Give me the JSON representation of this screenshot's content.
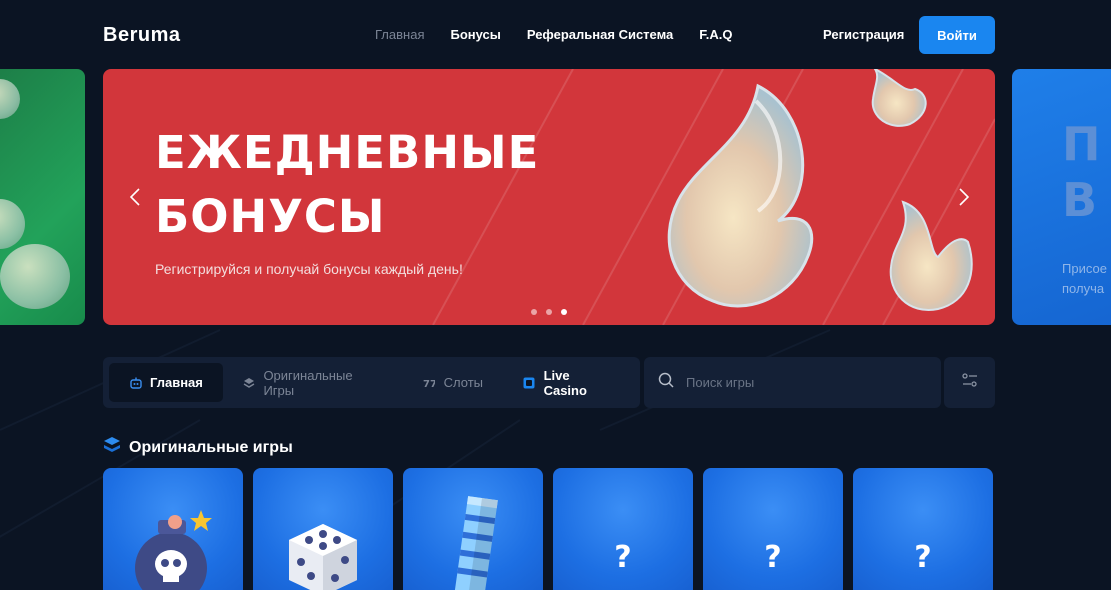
{
  "header": {
    "logo": "Beruma",
    "nav": [
      {
        "label": "Главная",
        "active": true
      },
      {
        "label": "Бонусы",
        "active": false
      },
      {
        "label": "Реферальная Система",
        "active": false
      },
      {
        "label": "F.A.Q",
        "active": false
      }
    ],
    "register_label": "Регистрация",
    "login_label": "Войти"
  },
  "slider": {
    "hero_title_line1": "ЕЖЕДНЕВНЫЕ",
    "hero_title_line2": "БОНУСЫ",
    "hero_subtitle": "Регистрируйся и получай бонусы каждый день!",
    "dots_count": 3,
    "active_dot": 3,
    "right_slide_big1": "П",
    "right_slide_big2": "В",
    "right_slide_text1": "Присое",
    "right_slide_text2": "получа"
  },
  "tabs": [
    {
      "label": "Главная",
      "icon": "home-icon",
      "active": true
    },
    {
      "label": "Оригинальные Игры",
      "icon": "stack-icon",
      "active": false
    },
    {
      "label": "Слоты",
      "icon": "slots-icon",
      "active": false
    },
    {
      "label": "Live Casino",
      "icon": "live-icon",
      "active": false
    }
  ],
  "search": {
    "placeholder": "Поиск игры"
  },
  "section": {
    "title": "Оригинальные игры",
    "icon": "stack-icon"
  },
  "games": [
    {
      "type": "mines",
      "icon": "bomb-icon"
    },
    {
      "type": "dice",
      "icon": "dice-icon"
    },
    {
      "type": "tower",
      "icon": "tower-icon"
    },
    {
      "type": "unknown",
      "label": "?"
    },
    {
      "type": "unknown",
      "label": "?"
    },
    {
      "type": "unknown",
      "label": "?"
    }
  ],
  "colors": {
    "background": "#0b1423",
    "accent": "#1a86f0",
    "hero": "#d2363b",
    "panel": "#142036"
  }
}
